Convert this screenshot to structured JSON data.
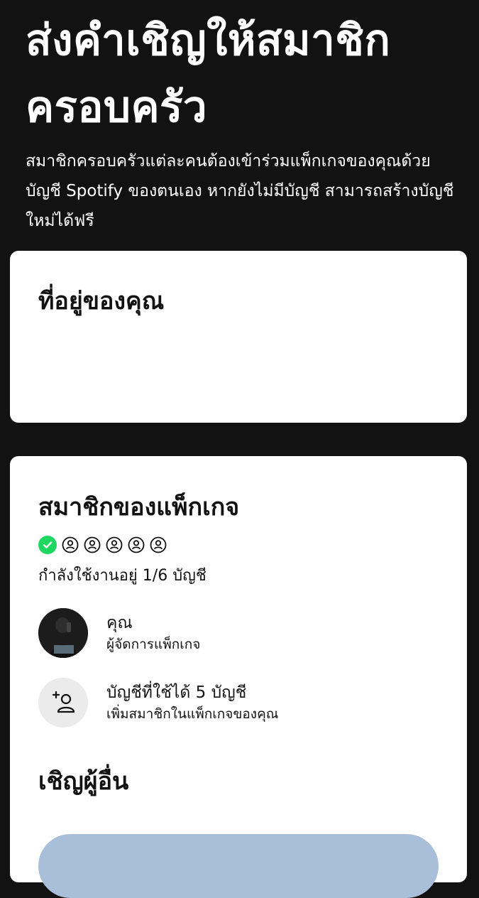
{
  "header": {
    "title": "ส่งคำเชิญให้สมาชิกครอบครัว",
    "subtitle": "สมาชิกครอบครัวแต่ละคนต้องเข้าร่วมแพ็กเกจของคุณด้วยบัญชี Spotify ของตนเอง หากยังไม่มีบัญชี สามารถสร้างบัญชีใหม่ได้ฟรี"
  },
  "address_card": {
    "title": "ที่อยู่ของคุณ"
  },
  "members_card": {
    "title": "สมาชิกของแพ็กเกจ",
    "slots": {
      "filled": 1,
      "total": 6,
      "filled_icon": "check-circle-icon",
      "empty_icon": "person-outline-icon"
    },
    "usage_text": "กำลังใช้งานอยู่ 1/6 บัญชี",
    "members": [
      {
        "name": "คุณ",
        "role": "ผู้จัดการแพ็กเกจ",
        "icon": "avatar"
      }
    ],
    "add_member": {
      "title": "บัญชีที่ใช้ได้ 5 บัญชี",
      "subtitle": "เพิ่มสมาชิกในแพ็กเกจของคุณ",
      "icon": "add-person-icon"
    },
    "invite_title": "เชิญผู้อื่น"
  },
  "colors": {
    "background": "#121212",
    "card": "#ffffff",
    "accent_green": "#1ed760",
    "invite_button": "#a9bed8"
  }
}
